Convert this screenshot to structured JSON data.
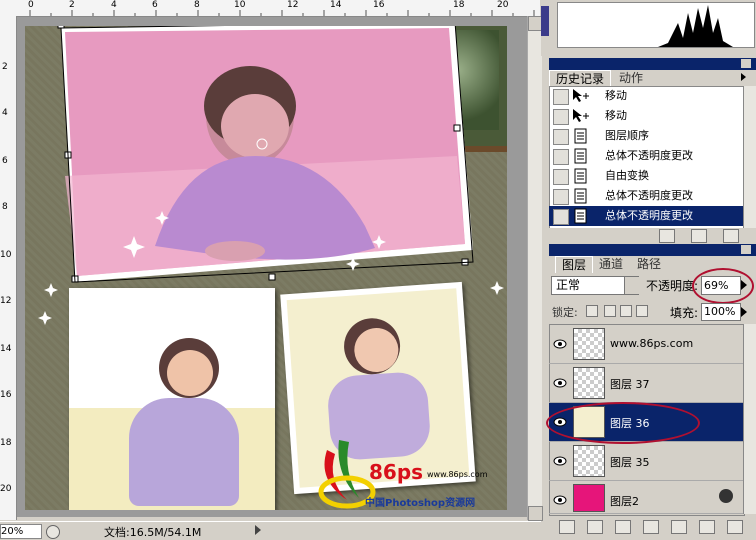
{
  "ruler": {
    "top_numbers": [
      "0",
      "2",
      "4",
      "6",
      "8",
      "10",
      "12",
      "14",
      "16",
      "18",
      "20"
    ],
    "left_numbers": [
      "2",
      "4",
      "6",
      "8",
      "10",
      "12",
      "14",
      "16",
      "18",
      "20"
    ]
  },
  "status": {
    "zoom": "20%",
    "doc_info": "文档:16.5M/54.1M"
  },
  "history": {
    "tabs": [
      "历史记录",
      "动作"
    ],
    "items": [
      "移动",
      "移动",
      "图层顺序",
      "总体不透明度更改",
      "自由变换",
      "总体不透明度更改",
      "总体不透明度更改"
    ],
    "selected_index": 6
  },
  "layers": {
    "tabs": [
      "图层",
      "通道",
      "路径"
    ],
    "blend_mode": "正常",
    "opacity_label": "不透明度:",
    "opacity_value": "69%",
    "lock_label": "锁定:",
    "fill_label": "填充:",
    "fill_value": "100%",
    "items": [
      "www.86ps.com",
      "图层 37",
      "图层 36",
      "图层 35",
      "图层2"
    ],
    "selected_index": 2
  },
  "watermark": {
    "brand": "86ps",
    "site": "www.86ps.com",
    "tagline": "中国Photoshop资源网"
  },
  "colors": {
    "accent": "#0a246a",
    "highlight_circle": "#b01030",
    "panel_bg": "#d4d0c8"
  }
}
